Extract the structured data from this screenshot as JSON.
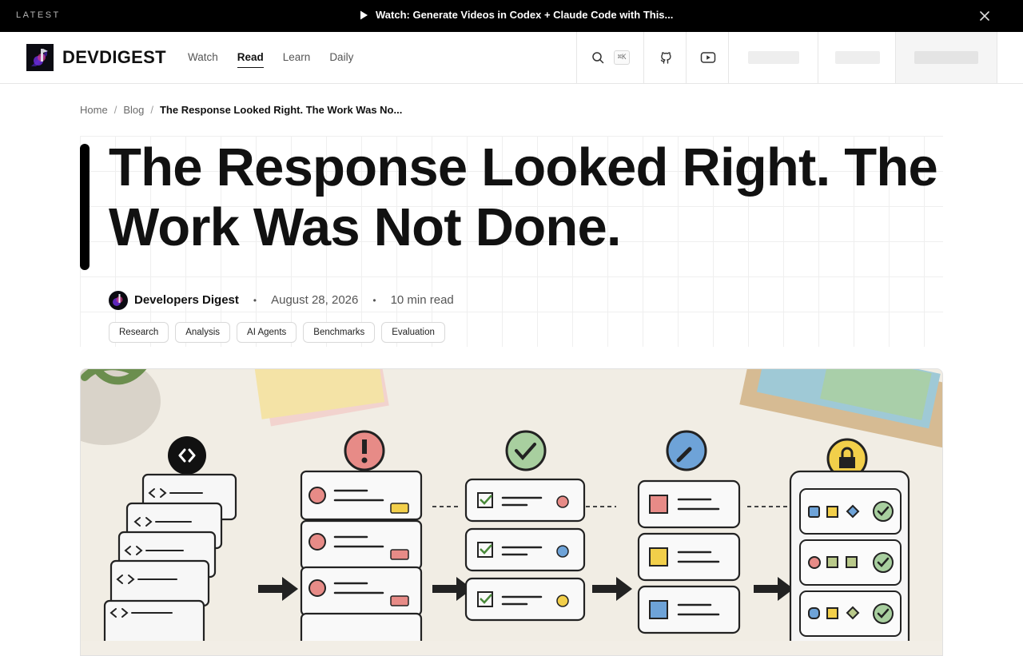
{
  "announcement": {
    "latest_label": "LATEST",
    "promo_text": "Watch: Generate Videos in Codex + Claude Code with This...",
    "close_icon": "close-icon"
  },
  "header": {
    "brand_name": "DEVDIGEST",
    "nav": [
      {
        "label": "Watch",
        "active": false
      },
      {
        "label": "Read",
        "active": true
      },
      {
        "label": "Learn",
        "active": false
      },
      {
        "label": "Daily",
        "active": false
      }
    ],
    "search_shortcut": "⌘K",
    "icons": [
      "search-icon",
      "github-icon",
      "youtube-icon"
    ]
  },
  "breadcrumb": {
    "items": [
      "Home",
      "Blog"
    ],
    "separator": "/",
    "current": "The Response Looked Right. The Work Was No..."
  },
  "article": {
    "title": "The Response Looked Right. The Work Was Not Done.",
    "author": "Developers Digest",
    "date": "August 28, 2026",
    "read_time": "10 min read",
    "meta_separator": "•",
    "tags": [
      "Research",
      "Analysis",
      "AI Agents",
      "Benchmarks",
      "Evaluation"
    ]
  },
  "colors": {
    "topbar_bg": "#000000",
    "accent": "#000000",
    "grid_line": "#efefef",
    "hero_bg": "#f2eee6"
  }
}
